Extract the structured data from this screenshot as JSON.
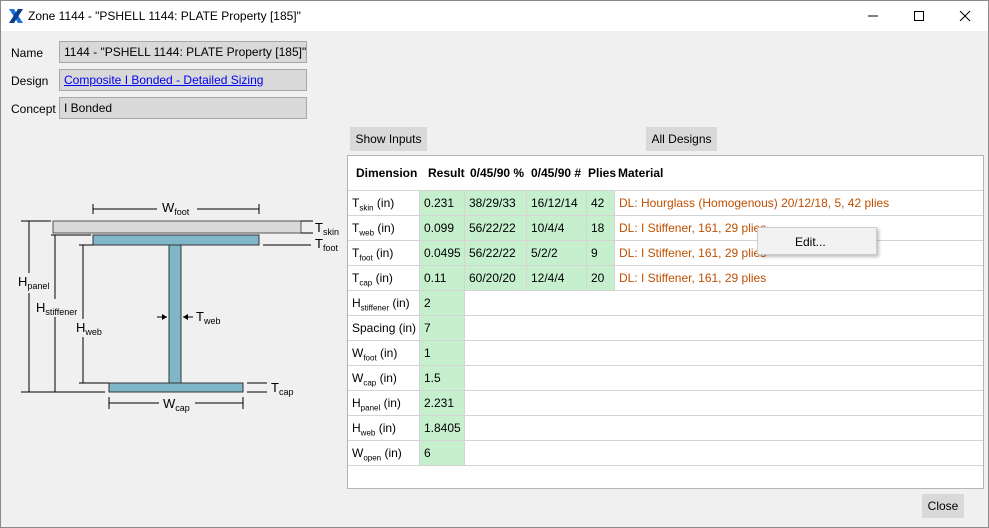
{
  "window": {
    "title": "Zone 1144 - \"PSHELL 1144: PLATE Property [185]\""
  },
  "form": {
    "name_label": "Name",
    "name_value": "1144 - \"PSHELL 1144: PLATE Property [185]\"",
    "design_label": "Design",
    "design_value": "Composite I Bonded - Detailed Sizing",
    "concept_label": "Concept",
    "concept_value": "I Bonded"
  },
  "buttons": {
    "show_inputs": "Show Inputs",
    "all_designs": "All Designs",
    "close": "Close"
  },
  "diagram": {
    "w_foot": "W",
    "w_foot_sub": "foot",
    "t_skin": "T",
    "t_skin_sub": "skin",
    "t_foot": "T",
    "t_foot_sub": "foot",
    "h_panel": "H",
    "h_panel_sub": "panel",
    "h_stiffener": "H",
    "h_stiffener_sub": "stiffener",
    "h_web": "H",
    "h_web_sub": "web",
    "t_web": "T",
    "t_web_sub": "web",
    "t_cap": "T",
    "t_cap_sub": "cap",
    "w_cap": "W",
    "w_cap_sub": "cap"
  },
  "table": {
    "headers": [
      "Dimension",
      "Result",
      "0/45/90 %",
      "0/45/90 #",
      "Plies",
      "Material"
    ],
    "laminate_rows": [
      {
        "dim": "T",
        "sub": "skin",
        "unit": " (in)",
        "result": "0.231",
        "pct": "38/29/33",
        "num": "16/12/14",
        "plies": "42",
        "material": "DL: Hourglass (Homogenous) 20/12/18, 5, 42 plies"
      },
      {
        "dim": "T",
        "sub": "web",
        "unit": " (in)",
        "result": "0.099",
        "pct": "56/22/22",
        "num": "10/4/4",
        "plies": "18",
        "material": "DL: I Stiffener, 161, 29 plies"
      },
      {
        "dim": "T",
        "sub": "foot",
        "unit": " (in)",
        "result": "0.0495",
        "pct": "56/22/22",
        "num": "5/2/2",
        "plies": "9",
        "material": "DL: I Stiffener, 161, 29 plies"
      },
      {
        "dim": "T",
        "sub": "cap",
        "unit": " (in)",
        "result": "0.11",
        "pct": "60/20/20",
        "num": "12/4/4",
        "plies": "20",
        "material": "DL: I Stiffener, 161, 29 plies"
      }
    ],
    "dimension_rows": [
      {
        "dim": "H",
        "sub": "stiffener",
        "unit": " (in)",
        "result": "2"
      },
      {
        "dim": "Spacing",
        "sub": "",
        "unit": " (in)",
        "result": "7"
      },
      {
        "dim": "W",
        "sub": "foot",
        "unit": " (in)",
        "result": "1"
      },
      {
        "dim": "W",
        "sub": "cap",
        "unit": " (in)",
        "result": "1.5"
      },
      {
        "dim": "H",
        "sub": "panel",
        "unit": " (in)",
        "result": "2.231"
      },
      {
        "dim": "H",
        "sub": "web",
        "unit": " (in)",
        "result": "1.8405"
      },
      {
        "dim": "W",
        "sub": "open",
        "unit": " (in)",
        "result": "6"
      }
    ]
  },
  "context_menu": {
    "edit": "Edit..."
  },
  "colors": {
    "accent_link": "#0000ee",
    "material_text": "#c05000",
    "result_fill": "#c6efce",
    "stiffener_fill": "#7fb7c9",
    "logo_blue": "#1e6fd9"
  }
}
